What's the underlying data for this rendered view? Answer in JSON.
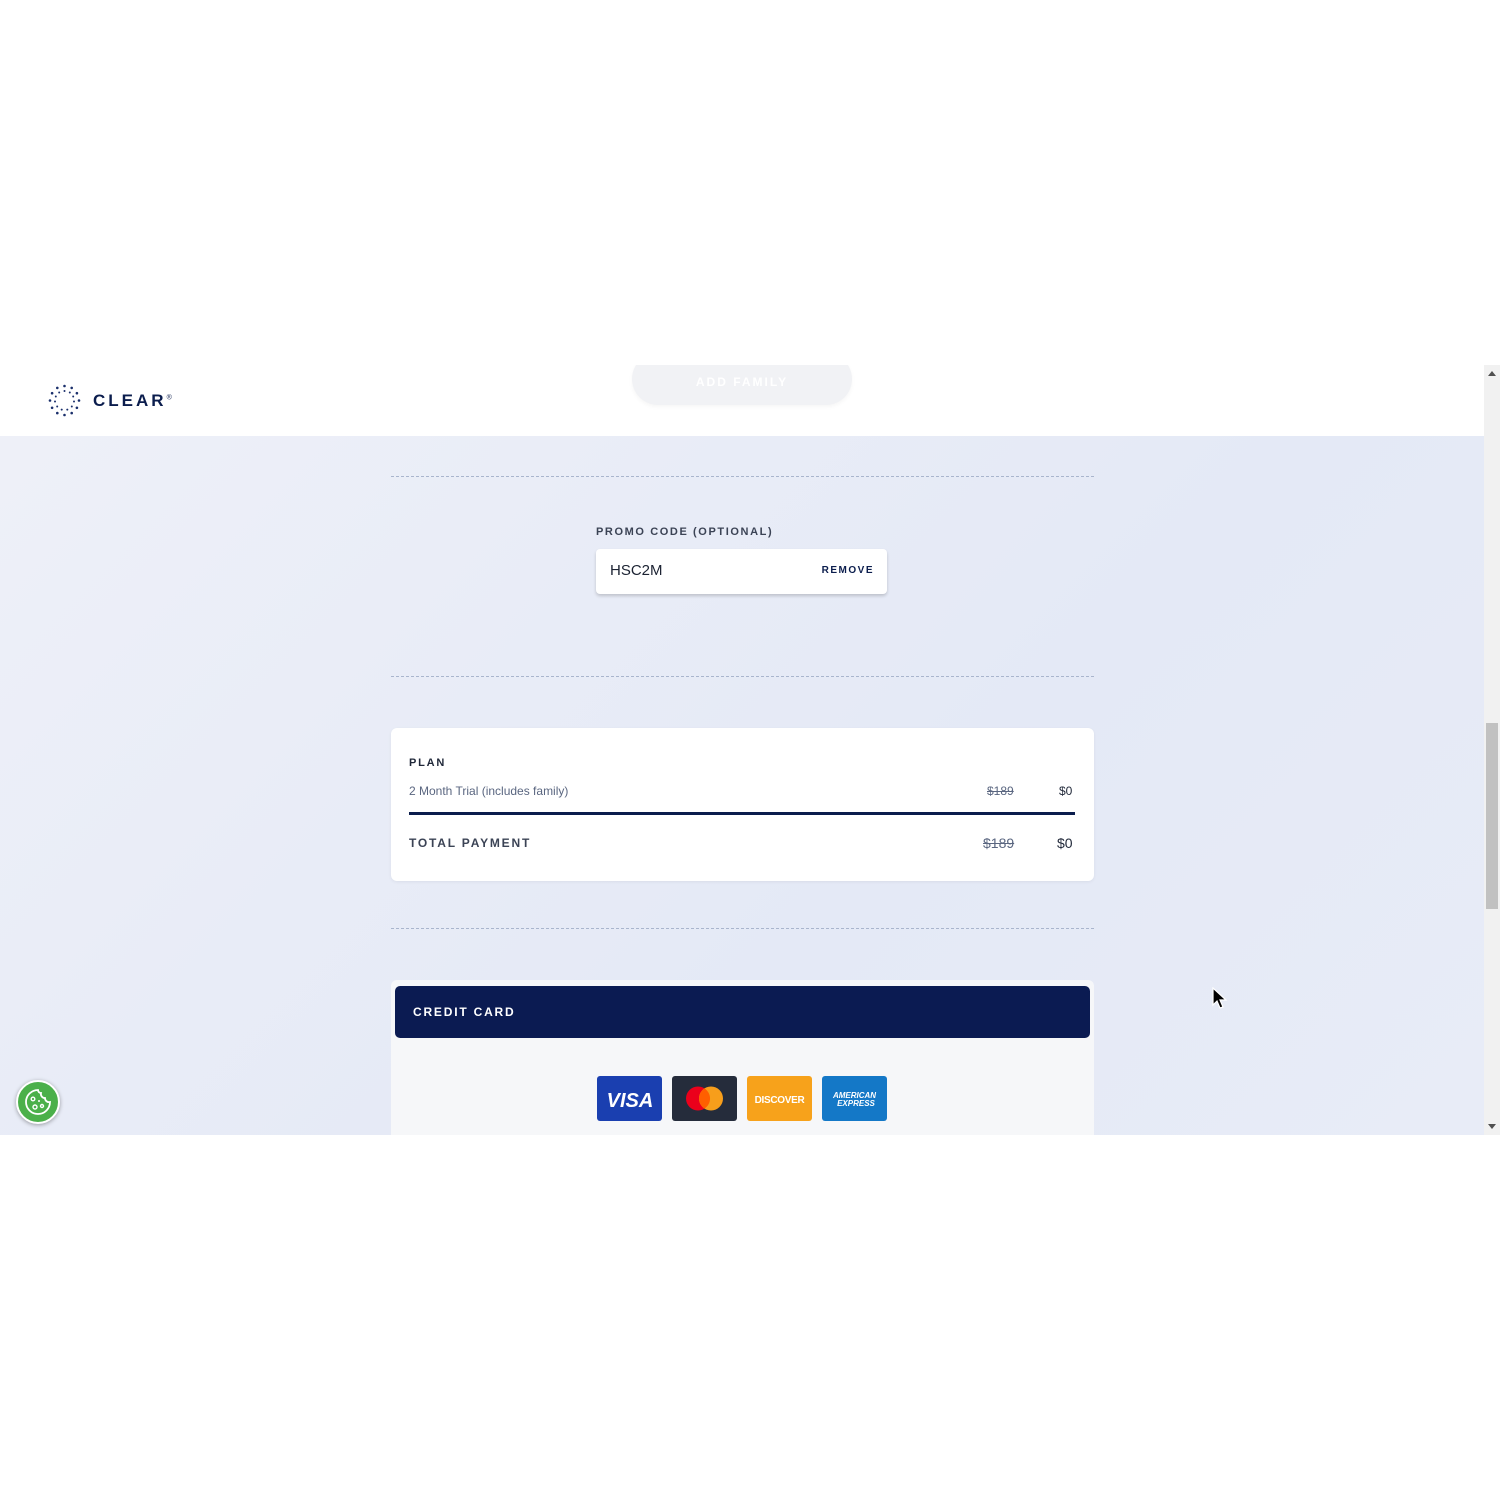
{
  "header": {
    "logo_text": "CLEAR",
    "logo_mark": "®",
    "add_family_label": "ADD FAMILY"
  },
  "promo": {
    "label": "PROMO CODE (OPTIONAL)",
    "value": "HSC2M",
    "remove_label": "REMOVE"
  },
  "plan": {
    "heading": "PLAN",
    "name": "2 Month Trial (includes family)",
    "old_price": "$189",
    "new_price": "$0",
    "total_label": "TOTAL PAYMENT",
    "total_old": "$189",
    "total_new": "$0"
  },
  "payment": {
    "credit_card_label": "CREDIT CARD",
    "card_logos": [
      {
        "name": "visa",
        "text": "VISA",
        "color": "#1a3fb0"
      },
      {
        "name": "mastercard",
        "text": "",
        "color": "#252c3b"
      },
      {
        "name": "discover",
        "text": "DISCOVER",
        "color": "#f79e1b"
      },
      {
        "name": "american-express",
        "text": "AMERICAN EXPRESS",
        "color": "#1478c7"
      }
    ]
  },
  "icons": {
    "logo": "clear-dots-logo-icon",
    "cookie": "cookie-icon",
    "cursor": "mouse-pointer-icon"
  },
  "colors": {
    "brand_navy": "#0b1b52",
    "background": "#e6eaf6",
    "cookie_green": "#4bb04a"
  }
}
